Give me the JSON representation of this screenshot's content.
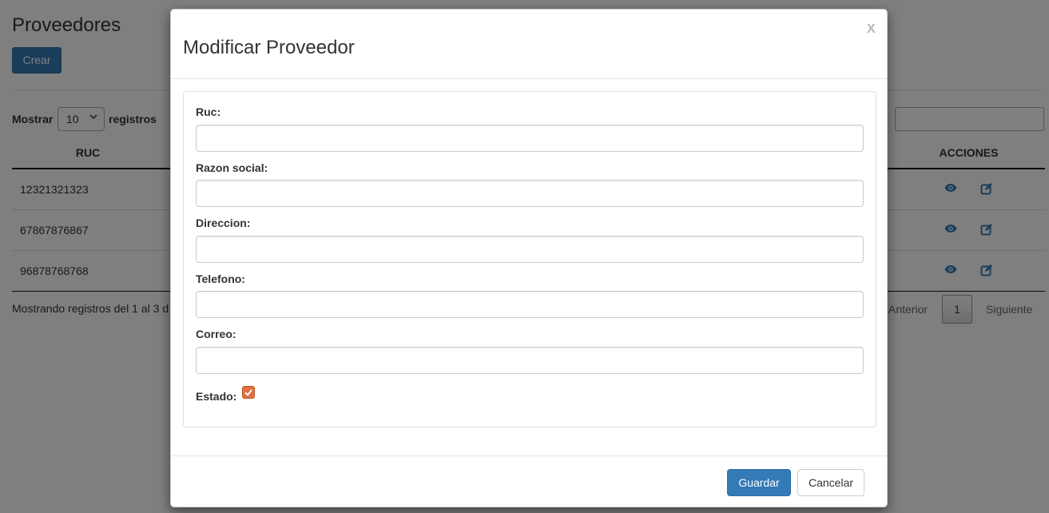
{
  "page": {
    "title": "Proveedores",
    "create_label": "Crear"
  },
  "length": {
    "show_label": "Mostrar",
    "selected": "10",
    "records_label": "registros"
  },
  "table": {
    "columns": {
      "ruc": "RUC",
      "actions": "ACCIONES"
    },
    "rows": [
      {
        "ruc": "12321321323"
      },
      {
        "ruc": "67867876867"
      },
      {
        "ruc": "96878768768"
      }
    ],
    "info": "Mostrando registros del 1 al 3 d"
  },
  "pagination": {
    "prev": "Anterior",
    "current": "1",
    "next": "Siguiente"
  },
  "icons": {
    "view": "eye-icon",
    "edit": "edit-icon"
  },
  "colors": {
    "primary": "#337ab7",
    "checkbox": "#e0703f",
    "backdrop": "rgba(0,0,0,0.5)"
  },
  "modal": {
    "title": "Modificar Proveedor",
    "close": "x",
    "fields": {
      "ruc": {
        "label": "Ruc:",
        "value": ""
      },
      "razon_social": {
        "label": "Razon social:",
        "value": ""
      },
      "direccion": {
        "label": "Direccion:",
        "value": ""
      },
      "telefono": {
        "label": "Telefono:",
        "value": ""
      },
      "correo": {
        "label": "Correo:",
        "value": ""
      }
    },
    "estado": {
      "label": "Estado:",
      "checked": true
    },
    "save_label": "Guardar",
    "cancel_label": "Cancelar"
  }
}
